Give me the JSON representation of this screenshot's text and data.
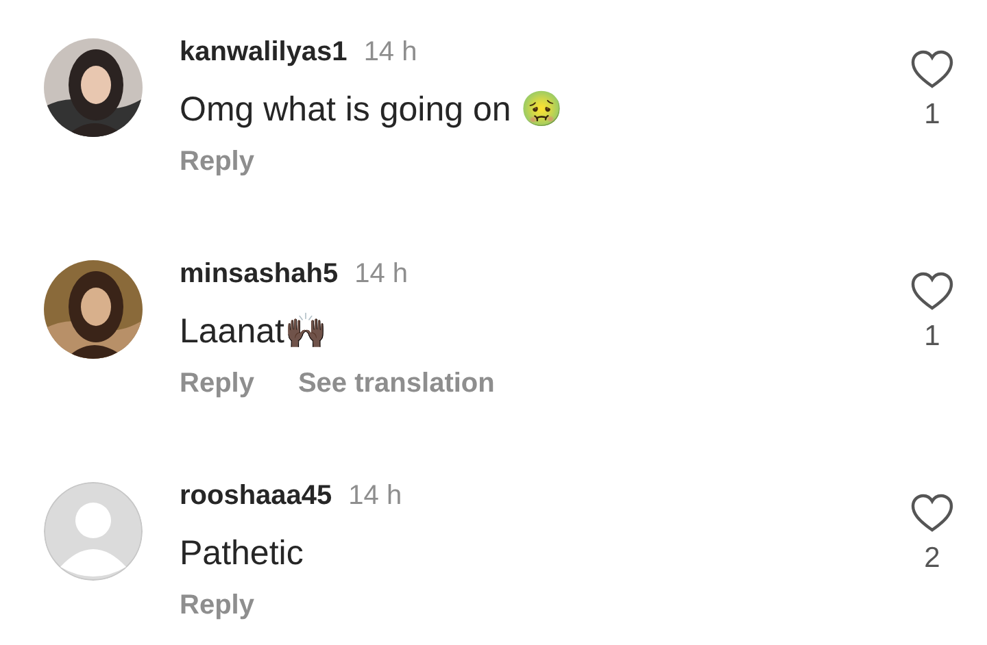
{
  "comments": [
    {
      "avatar": {
        "kind": "picture"
      },
      "username": "kanwalilyas1",
      "time": "14 h",
      "text": "Omg what is going on 🤢",
      "actions": [
        "Reply"
      ],
      "likes": "1",
      "liked": false
    },
    {
      "avatar": {
        "kind": "picture"
      },
      "username": "minsashah5",
      "time": "14 h",
      "text": "Laanat🙌🏿",
      "actions": [
        "Reply",
        "See translation"
      ],
      "likes": "1",
      "liked": false
    },
    {
      "avatar": {
        "kind": "default"
      },
      "username": "rooshaaa45",
      "time": "14 h",
      "text": "Pathetic",
      "actions": [
        "Reply"
      ],
      "likes": "2",
      "liked": false
    }
  ]
}
